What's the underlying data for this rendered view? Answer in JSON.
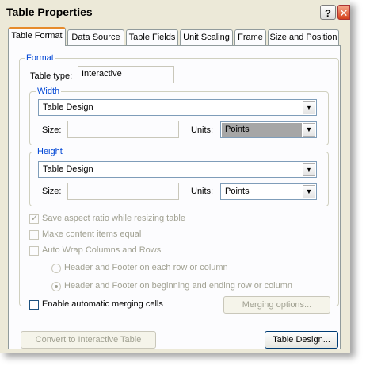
{
  "window": {
    "title": "Table Properties",
    "help_glyph": "?",
    "close_glyph": "✕"
  },
  "tabs": [
    {
      "label": "Table Format",
      "active": true
    },
    {
      "label": "Data Source"
    },
    {
      "label": "Table Fields"
    },
    {
      "label": "Unit Scaling"
    },
    {
      "label": "Frame"
    },
    {
      "label": "Size and Position"
    }
  ],
  "format": {
    "legend": "Format",
    "table_type_label": "Table type:",
    "table_type_value": "Interactive"
  },
  "width": {
    "legend": "Width",
    "mode": "Table Design",
    "size_label": "Size:",
    "size_value": "",
    "units_label": "Units:",
    "units_value": "Points"
  },
  "height": {
    "legend": "Height",
    "mode": "Table Design",
    "size_label": "Size:",
    "size_value": "",
    "units_label": "Units:",
    "units_value": "Points"
  },
  "options": {
    "save_aspect": "Save aspect ratio while resizing table",
    "content_equal": "Make content items equal",
    "auto_wrap": "Auto Wrap Columns and Rows",
    "header_each": "Header and Footer on each row or column",
    "header_begin_end": "Header and Footer on beginning and ending row or column",
    "auto_merge": "Enable automatic merging cells",
    "merging_options": "Merging options..."
  },
  "buttons": {
    "convert": "Convert to Interactive Table",
    "table_design": "Table Design..."
  },
  "dropdown_arrow": "▼"
}
